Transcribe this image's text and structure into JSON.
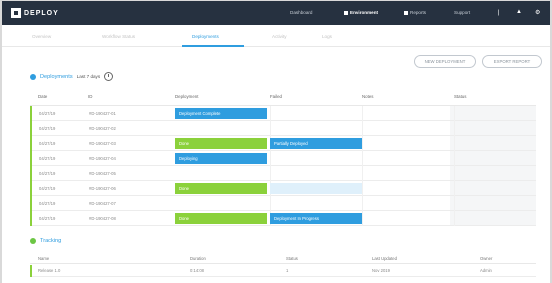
{
  "brand": {
    "name": "DEPLOY",
    "accent": "#2f9ddf",
    "success": "#8bd13b",
    "topbar_bg": "#263140"
  },
  "topbar": {
    "items": [
      {
        "label": "Dashboard",
        "active": false
      },
      {
        "label": "Environment",
        "active": true
      },
      {
        "label": "Reports",
        "active": false
      },
      {
        "label": "Support",
        "active": false
      }
    ],
    "icons": [
      "user-icon",
      "bell-icon",
      "settings-icon"
    ]
  },
  "tabs": [
    {
      "label": "Overview",
      "active": false
    },
    {
      "label": "Workflow Status",
      "active": false
    },
    {
      "label": "Deployments",
      "active": true
    },
    {
      "label": "Activity",
      "active": false
    },
    {
      "label": "Logs",
      "active": false
    }
  ],
  "actions": {
    "create": "NEW DEPLOYMENT",
    "download": "EXPORT REPORT"
  },
  "deployments": {
    "title": "Deployments",
    "subtitle": "Last 7 days",
    "columns": [
      "Date",
      "ID",
      "Deployment",
      "Failed",
      "Notes",
      "Status"
    ],
    "rows": [
      {
        "date": "04/27/19",
        "id": "#D-190427-01",
        "bar": {
          "label": "Deployment Complete",
          "color": "blue",
          "col": 2
        }
      },
      {
        "date": "04/27/19",
        "id": "#D-190427-02",
        "bar": null
      },
      {
        "date": "04/27/19",
        "id": "#D-190427-03",
        "bar": {
          "label": "Done",
          "color": "green",
          "col": 2
        },
        "bar2": {
          "label": "Partially Deployed",
          "color": "blue",
          "col": 3
        }
      },
      {
        "date": "04/27/19",
        "id": "#D-190427-04",
        "bar": {
          "label": "Deploying",
          "color": "blue",
          "col": 2
        }
      },
      {
        "date": "04/27/19",
        "id": "#D-190427-05",
        "bar": null
      },
      {
        "date": "04/27/19",
        "id": "#D-190427-06",
        "bar": {
          "label": "Done",
          "color": "green",
          "col": 2
        },
        "bar2": {
          "label": "",
          "color": "ghost",
          "col": 3
        }
      },
      {
        "date": "04/27/19",
        "id": "#D-190427-07",
        "bar": null
      },
      {
        "date": "04/27/19",
        "id": "#D-190427-08",
        "bar": {
          "label": "Done",
          "color": "green",
          "col": 2
        },
        "bar2": {
          "label": "Deployment In Progress",
          "color": "blue",
          "col": 3
        }
      }
    ]
  },
  "tracking": {
    "title": "Tracking",
    "columns": [
      "Name",
      "Duration",
      "Status",
      "Last Updated",
      "Owner"
    ],
    "row": [
      "Release 1.0",
      "0:14:08",
      "1",
      "Nov 2019",
      "Admin"
    ]
  }
}
